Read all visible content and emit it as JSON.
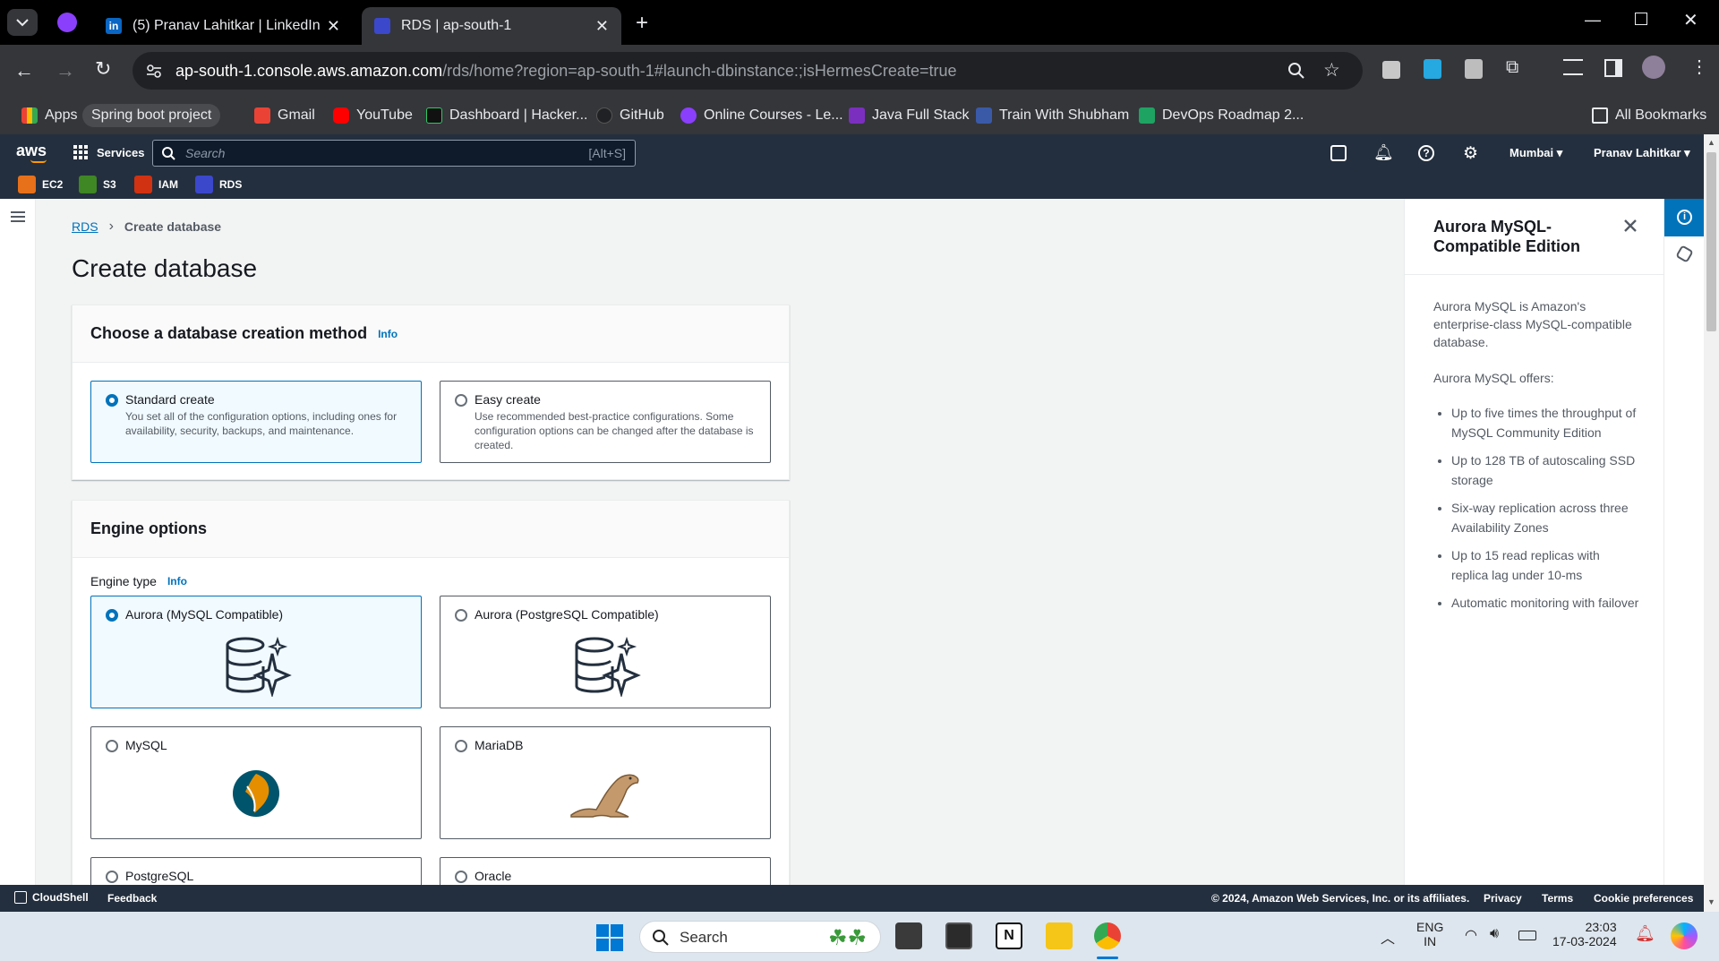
{
  "browser": {
    "tabs": [
      {
        "title": "(5) Pranav Lahitkar | LinkedIn"
      },
      {
        "title": "RDS | ap-south-1"
      }
    ],
    "url_host": "ap-south-1.console.aws.amazon.com",
    "url_path": "/rds/home?region=ap-south-1#launch-dbinstance:;isHermesCreate=true",
    "bookmarks": [
      "Apps",
      "Spring boot project",
      "Gmail",
      "YouTube",
      "Dashboard | Hacker...",
      "GitHub",
      "Online Courses - Le...",
      "Java Full Stack",
      "Train With Shubham",
      "DevOps Roadmap 2..."
    ],
    "all_bookmarks": "All Bookmarks"
  },
  "aws": {
    "logo": "aws",
    "services": "Services",
    "search_placeholder": "Search",
    "search_shortcut": "[Alt+S]",
    "region": "Mumbai",
    "user": "Pranav Lahitkar",
    "favorites": [
      "EC2",
      "S3",
      "IAM",
      "RDS"
    ],
    "favorite_colors": [
      "#e7701a",
      "#3f8624",
      "#d13212",
      "#3b48cc"
    ]
  },
  "page": {
    "breadcrumb_root": "RDS",
    "breadcrumb_current": "Create database",
    "title": "Create database",
    "info": "Info",
    "method": {
      "heading": "Choose a database creation method",
      "options": [
        {
          "label": "Standard create",
          "desc": "You set all of the configuration options, including ones for availability, security, backups, and maintenance.",
          "selected": true
        },
        {
          "label": "Easy create",
          "desc": "Use recommended best-practice configurations. Some configuration options can be changed after the database is created.",
          "selected": false
        }
      ]
    },
    "engine": {
      "heading": "Engine options",
      "type_label": "Engine type",
      "options": [
        {
          "label": "Aurora (MySQL Compatible)",
          "selected": true
        },
        {
          "label": "Aurora (PostgreSQL Compatible)",
          "selected": false
        },
        {
          "label": "MySQL",
          "selected": false
        },
        {
          "label": "MariaDB",
          "selected": false
        },
        {
          "label": "PostgreSQL",
          "selected": false
        },
        {
          "label": "Oracle",
          "selected": false
        }
      ]
    }
  },
  "help": {
    "title": "Aurora MySQL-Compatible Edition",
    "intro": "Aurora MySQL is Amazon's enterprise-class MySQL-compatible database.",
    "offers": "Aurora MySQL offers:",
    "bullets": [
      "Up to five times the throughput of MySQL Community Edition",
      "Up to 128 TB of autoscaling SSD storage",
      "Six-way replication across three Availability Zones",
      "Up to 15 read replicas with replica lag under 10-ms",
      "Automatic monitoring with failover"
    ]
  },
  "footer": {
    "cloudshell": "CloudShell",
    "feedback": "Feedback",
    "copyright": "© 2024, Amazon Web Services, Inc. or its affiliates.",
    "privacy": "Privacy",
    "terms": "Terms",
    "cookies": "Cookie preferences"
  },
  "taskbar": {
    "search": "Search",
    "lang1": "ENG",
    "lang2": "IN",
    "time": "23:03",
    "date": "17-03-2024"
  }
}
